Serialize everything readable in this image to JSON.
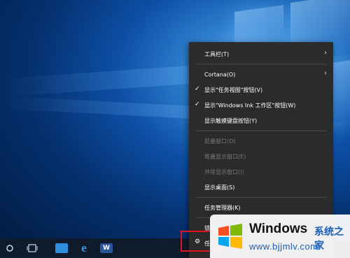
{
  "context_menu": {
    "items": [
      {
        "label": "工具栏(T)",
        "checked": false,
        "submenu": true,
        "disabled": false
      },
      {
        "label": "Cortana(O)",
        "checked": false,
        "submenu": true,
        "disabled": false
      },
      {
        "label": "显示\"任务视图\"按钮(V)",
        "checked": true,
        "submenu": false,
        "disabled": false
      },
      {
        "label": "显示\"Windows Ink 工作区\"按钮(W)",
        "checked": true,
        "submenu": false,
        "disabled": false
      },
      {
        "label": "显示触摸键盘按钮(Y)",
        "checked": false,
        "submenu": false,
        "disabled": false
      },
      {
        "label": "层叠窗口(D)",
        "checked": false,
        "submenu": false,
        "disabled": true
      },
      {
        "label": "堆叠显示窗口(E)",
        "checked": false,
        "submenu": false,
        "disabled": true
      },
      {
        "label": "并排显示窗口(I)",
        "checked": false,
        "submenu": false,
        "disabled": true
      },
      {
        "label": "显示桌面(S)",
        "checked": false,
        "submenu": false,
        "disabled": false
      },
      {
        "label": "任务管理器(K)",
        "checked": false,
        "submenu": false,
        "disabled": false
      },
      {
        "label": "锁定",
        "checked": false,
        "submenu": false,
        "disabled": false
      },
      {
        "label": "任",
        "checked": false,
        "submenu": false,
        "disabled": false
      }
    ],
    "check_glyph": "✓",
    "arrow_glyph": "›"
  },
  "taskbar": {
    "icons": [
      "search-icon",
      "task-view-icon",
      "file-explorer-icon",
      "edge-icon",
      "word-icon"
    ],
    "colors": {
      "explorer": "#2e8fdc",
      "edge": "#3a9be6",
      "word": "#2b579a"
    }
  },
  "watermark": {
    "title": "Windows",
    "subtitle": "系统之家",
    "url": "www.bjjmlv.com"
  },
  "colors": {
    "menu_bg": "#2b2b2b",
    "highlight": "#e0141e"
  }
}
